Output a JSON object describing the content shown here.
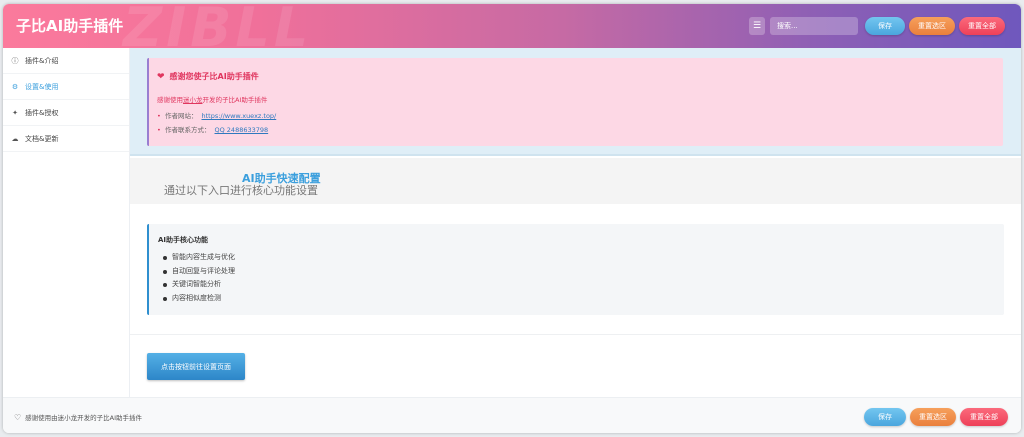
{
  "header": {
    "title": "子比AI助手插件",
    "watermark": "ZIBLL",
    "search_placeholder": "搜索...",
    "save_label": "保存",
    "reset_section_label": "重置选区",
    "reset_all_label": "重置全部"
  },
  "sidebar": {
    "items": [
      {
        "label": "插件&介绍",
        "icon": "info-icon"
      },
      {
        "label": "设置&使用",
        "icon": "gears-icon",
        "active": true
      },
      {
        "label": "插件&授权",
        "icon": "handshake-icon"
      },
      {
        "label": "文档&更新",
        "icon": "cloud-download-icon"
      }
    ]
  },
  "notice": {
    "title": "感谢您使子比AI助手插件",
    "subtitle_prefix": "感谢使用",
    "subtitle_author": "迷小龙",
    "subtitle_suffix": "开发的子比AI助手插件",
    "website_label": "作者网站：",
    "website_link": "https://www.xuexz.top/",
    "contact_label": "作者联系方式：",
    "contact_link": "QQ 2488633798"
  },
  "quick_config": {
    "title": "AI助手快速配置",
    "subtitle": "通过以下入口进行核心功能设置"
  },
  "features": {
    "title": "AI助手核心功能",
    "items": [
      "智能内容生成与优化",
      "自动回复与评论处理",
      "关键词智能分析",
      "内容相似度检测"
    ]
  },
  "goto_button_label": "点击按钮前往设置页面",
  "footer": {
    "credit": "感谢使用由迷小龙开发的子比AI助手插件",
    "save_label": "保存",
    "reset_section_label": "重置选区",
    "reset_all_label": "重置全部"
  },
  "colors": {
    "accent_blue": "#3b9fdd",
    "notice_pink": "#e0365f",
    "header_gradient_start": "#fb7a9c",
    "header_gradient_end": "#6f58bd"
  }
}
